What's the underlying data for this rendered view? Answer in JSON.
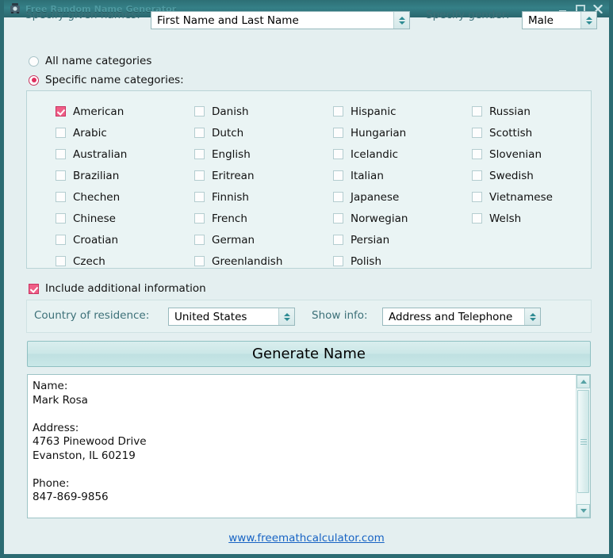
{
  "window": {
    "title": "Free Random Name Generator",
    "icon": "app-icon",
    "controls": {
      "minimize": "–",
      "maximize": "□",
      "close": "✕"
    }
  },
  "form": {
    "given_names_label": "Specify given names:",
    "given_names_value": "First Name and Last Name",
    "gender_label": "Specify gender:",
    "gender_value": "Male",
    "radio_all_label": "All name categories",
    "radio_specific_label": "Specific name categories:",
    "radio_selected": "specific"
  },
  "categories": {
    "columns": [
      [
        {
          "label": "American",
          "checked": true
        },
        {
          "label": "Arabic",
          "checked": false
        },
        {
          "label": "Australian",
          "checked": false
        },
        {
          "label": "Brazilian",
          "checked": false
        },
        {
          "label": "Chechen",
          "checked": false
        },
        {
          "label": "Chinese",
          "checked": false
        },
        {
          "label": "Croatian",
          "checked": false
        },
        {
          "label": "Czech",
          "checked": false
        }
      ],
      [
        {
          "label": "Danish",
          "checked": false
        },
        {
          "label": "Dutch",
          "checked": false
        },
        {
          "label": "English",
          "checked": false
        },
        {
          "label": "Eritrean",
          "checked": false
        },
        {
          "label": "Finnish",
          "checked": false
        },
        {
          "label": "French",
          "checked": false
        },
        {
          "label": "German",
          "checked": false
        },
        {
          "label": "Greenlandish",
          "checked": false
        }
      ],
      [
        {
          "label": "Hispanic",
          "checked": false
        },
        {
          "label": "Hungarian",
          "checked": false
        },
        {
          "label": "Icelandic",
          "checked": false
        },
        {
          "label": "Italian",
          "checked": false
        },
        {
          "label": "Japanese",
          "checked": false
        },
        {
          "label": "Norwegian",
          "checked": false
        },
        {
          "label": "Persian",
          "checked": false
        },
        {
          "label": "Polish",
          "checked": false
        }
      ],
      [
        {
          "label": "Russian",
          "checked": false
        },
        {
          "label": "Scottish",
          "checked": false
        },
        {
          "label": "Slovenian",
          "checked": false
        },
        {
          "label": "Swedish",
          "checked": false
        },
        {
          "label": "Vietnamese",
          "checked": false
        },
        {
          "label": "Welsh",
          "checked": false
        }
      ]
    ]
  },
  "additional": {
    "include_label": "Include additional information",
    "include_checked": true,
    "country_label": "Country of residence:",
    "country_value": "United States",
    "showinfo_label": "Show info:",
    "showinfo_value": "Address and Telephone"
  },
  "actions": {
    "generate_label": "Generate Name"
  },
  "result": {
    "text": "Name:\nMark Rosa\n\nAddress:\n4763 Pinewood Drive\nEvanston, IL 60219\n\nPhone:\n847-869-9856"
  },
  "footer": {
    "link_text": "www.freemathcalculator.com"
  },
  "colors": {
    "title_bar": "#2d6f75",
    "window_border": "#2b6b72",
    "background": "#e4eff0",
    "label_teal": "#3c7078",
    "checkbox_checked": "#ef5e86",
    "radio_checked": "#e02f5f",
    "link_blue": "#1763c4"
  }
}
